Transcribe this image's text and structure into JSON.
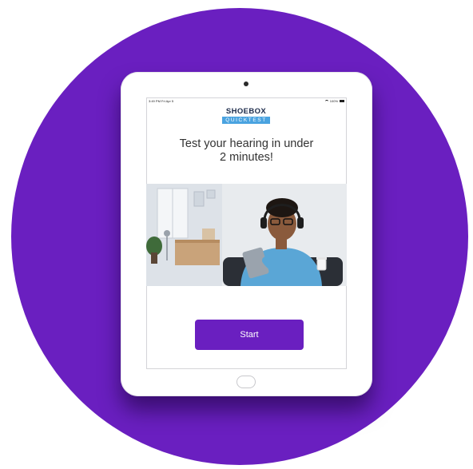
{
  "status_bar": {
    "time": "3:49 PM  Fri Apr 5",
    "battery": "100%"
  },
  "logo": {
    "top": "SHOEBOX",
    "bottom": "QUICKTEST"
  },
  "headline": {
    "line1": "Test your hearing in under",
    "line2": "2 minutes!"
  },
  "start_button": {
    "label": "Start"
  },
  "colors": {
    "brand_purple": "#6a1fc0",
    "logo_blue": "#4aa3e0",
    "logo_dark": "#1b2a4a"
  },
  "icons": [
    "wifi-icon",
    "battery-icon",
    "home-button"
  ]
}
